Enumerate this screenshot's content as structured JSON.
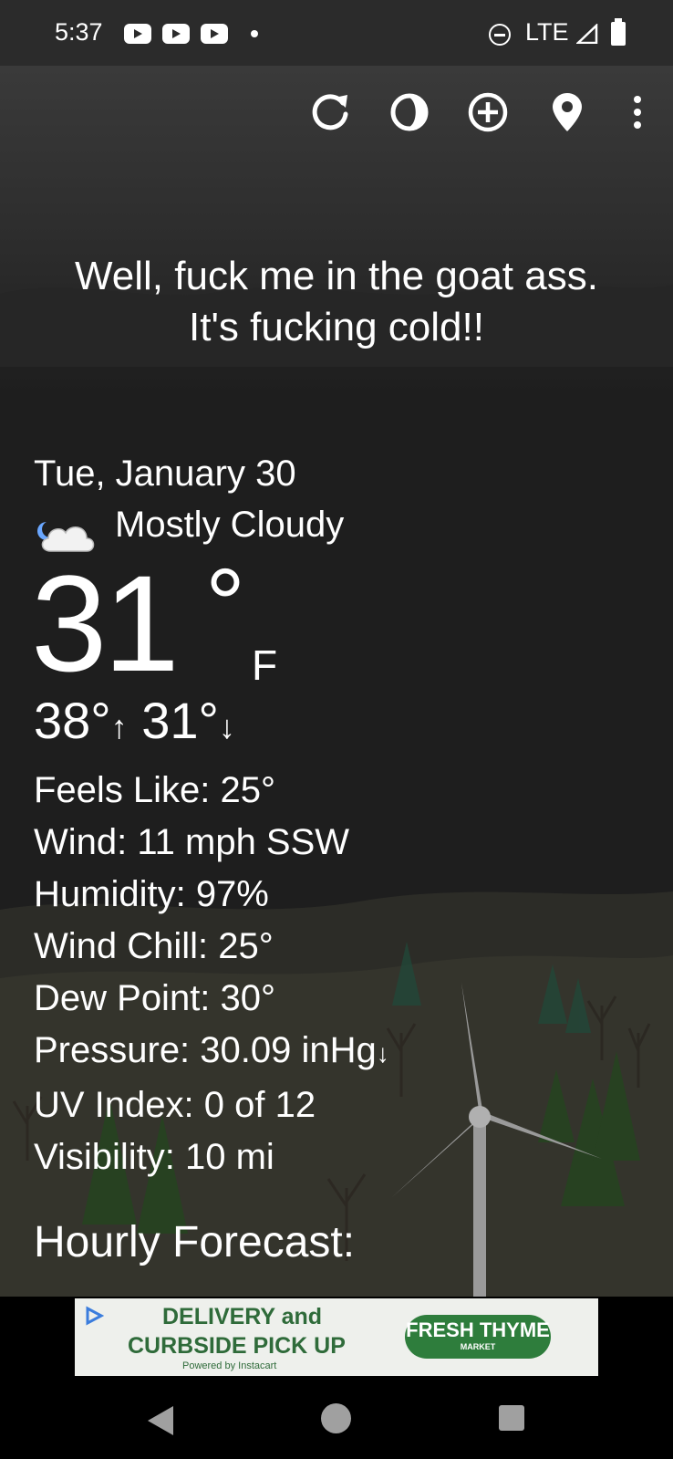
{
  "status_bar": {
    "time": "5:37",
    "network": "LTE"
  },
  "toolbar": {
    "icons": [
      "refresh-icon",
      "theme-icon",
      "add-location-icon",
      "location-pin-icon",
      "more-vert-icon"
    ]
  },
  "headline": {
    "line1": "Well, fuck me in the goat ass.",
    "line2": "It's fucking cold!!"
  },
  "weather": {
    "date": "Tue, January 30",
    "condition": "Mostly Cloudy",
    "temperature": "31",
    "degree": "°",
    "unit": "F",
    "high": "38°",
    "low": "31°",
    "details": {
      "feels_like": "Feels Like:  25°",
      "wind": "Wind:  11 mph SSW",
      "humidity": "Humidity:  97%",
      "wind_chill": "Wind Chill:  25°",
      "dew_point": "Dew Point:  30°",
      "pressure": "Pressure:  30.09 inHg",
      "uv_index": "UV Index:  0 of 12",
      "visibility": "Visibility:  10 mi"
    },
    "hourly_heading": "Hourly Forecast:"
  },
  "ad": {
    "line1": "DELIVERY and",
    "line2": "CURBSIDE PICK UP",
    "powered_by": "Powered by Instacart",
    "brand": "FRESH THYME",
    "brand_sub": "MARKET"
  },
  "colors": {
    "background": "#1c1c1c",
    "text": "#ffffff",
    "ad_green": "#2e7d3c"
  }
}
